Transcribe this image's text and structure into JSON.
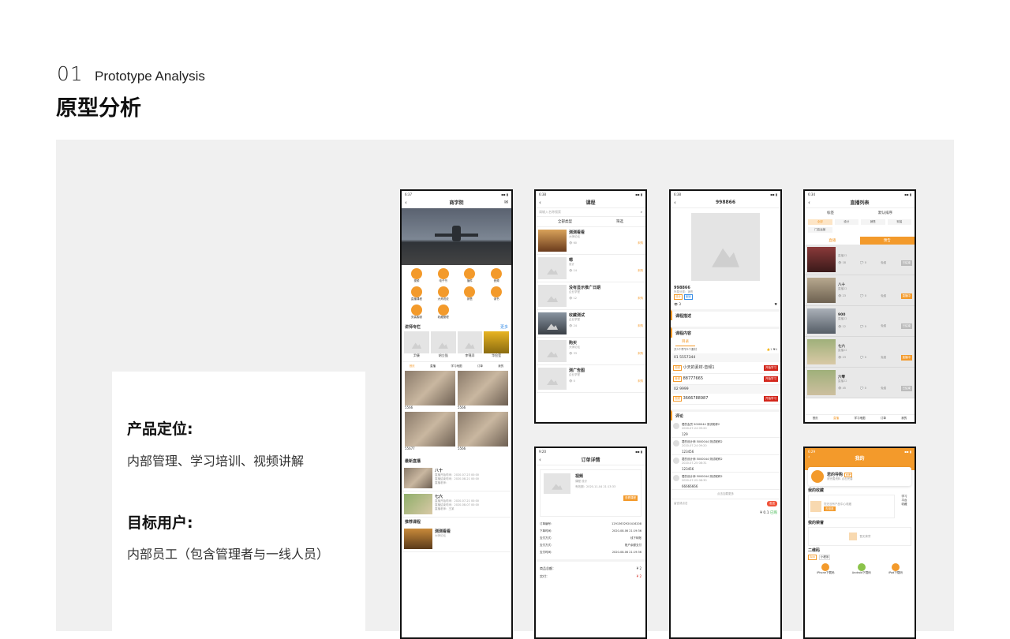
{
  "header": {
    "num": "01",
    "en": "Prototype Analysis",
    "cn": "原型分析"
  },
  "card": {
    "h1": "产品定位:",
    "t1": "内部管理、学习培训、视频讲解",
    "h2": "目标用户:",
    "t2": "内部员工（包含管理者与一线人员）"
  },
  "phone1": {
    "time": "6:37",
    "title": "商学院",
    "grid": [
      "视频",
      "电子书",
      "播件",
      "音频",
      "直播课程",
      "大师说说",
      "销售",
      "读书",
      "安装客服",
      "收藏管理"
    ],
    "lecturers_title": "讲师专栏",
    "more": "更多",
    "lecturers": [
      "尹康",
      "胡立强",
      "李锦添",
      "华捡莹"
    ],
    "tabs": [
      "首页",
      "直播",
      "学习地图",
      "订单",
      "我的"
    ],
    "prod": [
      "5566",
      "5566",
      "55677",
      "5566"
    ],
    "live_title": "最新直播",
    "live": [
      {
        "name": "八十",
        "l1": "直播开始时间：2020-07-23 00:00",
        "l2": "直播结束时间：2020-08-21 00:00",
        "l3": "直播老师："
      },
      {
        "name": "七六",
        "l1": "直播开始时间：2020-07-21 00:00",
        "l2": "直播结束时间：2020-08-07 00:00",
        "l3": "直播老师：王某"
      }
    ],
    "rec_title": "推荐课程",
    "rec": [
      {
        "name": "测测看看",
        "sub": "大师论坛"
      }
    ]
  },
  "phone2": {
    "time": "6:38",
    "title": "课程",
    "search_ph": "请输入名称搜索",
    "filter1": "全部类型",
    "filter2": "筛选",
    "items": [
      {
        "name": "测测看看",
        "sub": "大师论坛",
        "views": "60",
        "state": "未购"
      },
      {
        "name": "嗯",
        "sub": "设计",
        "views": "14",
        "state": "未购"
      },
      {
        "name": "没有显示推广日期",
        "sub": "企业学堂",
        "views": "12",
        "state": "未购"
      },
      {
        "name": "收藏测试",
        "sub": "企业学堂",
        "views": "24",
        "state": "未购"
      },
      {
        "name": "购买",
        "sub": "大师论坛",
        "views": "33",
        "state": "未购"
      },
      {
        "name": "测广告图",
        "sub": "企业学堂",
        "views": "0",
        "state": "未购"
      }
    ]
  },
  "phone3": {
    "time": "6:38",
    "title": "998866",
    "name": "998866",
    "cat": "所属分类：销售",
    "tags": [
      "设计",
      "营销"
    ],
    "views": "3",
    "desc_title": "课程描述",
    "content_title": "课程内容",
    "tab": "目录",
    "summary": "共3个章节3个素材",
    "likes": "1",
    "favs": "4",
    "ch1": "01  5557344",
    "l1": "小天的素材-音频1",
    "l2": "88777665",
    "ch2": "02  9999",
    "l3": "3666788987",
    "start": "开始学习",
    "comment_title": "评论",
    "comments": [
      {
        "u": "君的会员 5000044 测试昵称2",
        "d": "2020-07-24 09:20",
        "c": "129"
      },
      {
        "u": "君的设计师 5000044 测试昵称2",
        "d": "2020-07-24 09:20",
        "c": "123456"
      },
      {
        "u": "君的设计师 5000044 测试昵称2",
        "d": "2020-07-25 08:31",
        "c": "123456"
      },
      {
        "u": "君的设计师 5000044 测试昵称2",
        "d": "2020-07-25 08:30",
        "c": "66666666"
      }
    ],
    "load_more": "点击加载更多",
    "input_ph": "留言请点击",
    "send": "发送",
    "price": "¥ 0.1",
    "buy": "已购"
  },
  "phone4": {
    "time": "9:20",
    "title": "订单详情",
    "item": "视频",
    "item_sub": "课程 设计",
    "valid": "有效期：2020-11-04 21:13:33",
    "view_btn": "查看课程",
    "rows": [
      [
        "订单编号：",
        "12913632920416208"
      ],
      [
        "下单时间：",
        "2020-08-06 21:19:36"
      ],
      [
        "支付方式：",
        "线下转账"
      ],
      [
        "支付方式：",
        "账户余额支付"
      ],
      [
        "支付时间：",
        "2020-08-06 21:19:36"
      ]
    ],
    "total_l": "商品总额：",
    "total_v": "¥ 2",
    "paid_l": "实付：",
    "paid_v": "¥ 2"
  },
  "phone5": {
    "time": "6:34",
    "title": "直播列表",
    "f1": "标签",
    "f2": "默认排序",
    "cats": [
      "全部",
      "设计",
      "销售",
      "安装",
      "门店运营"
    ],
    "tab1": "直播",
    "tab2": "预告",
    "items": [
      {
        "name": "",
        "sub": "直播22",
        "views": "18",
        "c": "0",
        "p": "免费",
        "btn": "已结束"
      },
      {
        "name": "八十",
        "sub": "直播22",
        "views": "23",
        "c": "0",
        "p": "免费",
        "btn": "直播中"
      },
      {
        "name": "900",
        "sub": "直播22",
        "views": "12",
        "c": "0",
        "p": "免费",
        "btn": "已结束"
      },
      {
        "name": "七六",
        "sub": "直播22",
        "views": "23",
        "c": "0",
        "p": "免费",
        "btn": "直播中"
      },
      {
        "name": "六零",
        "sub": "直播22",
        "views": "45",
        "c": "0",
        "p": "免费",
        "btn": "已结束"
      }
    ],
    "tabs": [
      "首页",
      "直播",
      "学习地图",
      "订单",
      "我的"
    ]
  },
  "phone6": {
    "time": "6:29",
    "title": "我的",
    "user": "君的导购",
    "badge": "VIP",
    "user_sub": "请完善资料 点击完善",
    "fav_title": "我的收藏",
    "fav_empty": "您还没有产品中心收藏",
    "fav_btn": "去逛逛",
    "side": [
      "学习",
      "平台",
      "收藏"
    ],
    "honor_title": "我的荣誉",
    "honor_empty": "暂无荣誉",
    "qr_title": "二维码",
    "qr_tabs": [
      "App",
      "小程序"
    ],
    "dl": [
      "iPhone下载码",
      "Android下载码",
      "iPad下载码"
    ]
  }
}
